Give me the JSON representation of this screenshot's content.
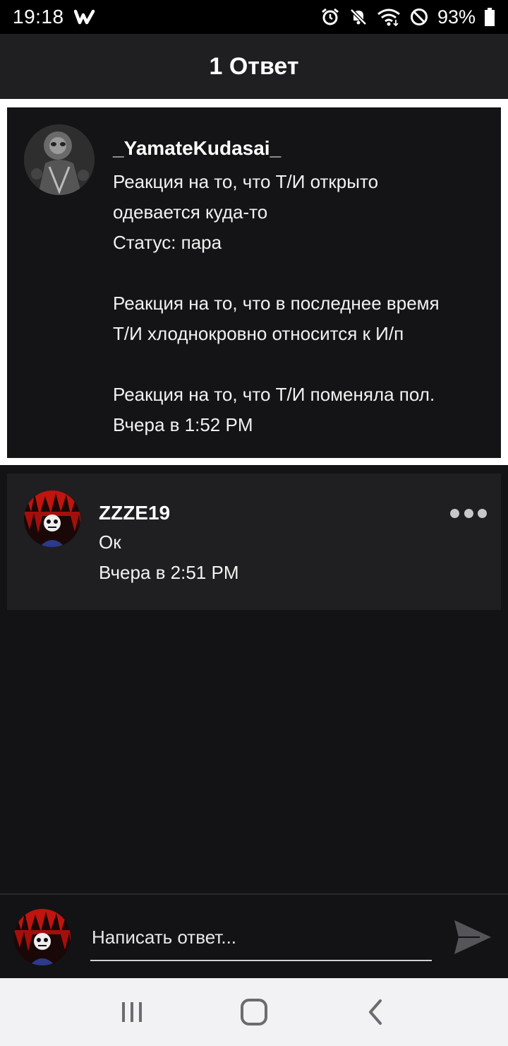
{
  "status_bar": {
    "time": "19:18",
    "battery_percent": "93%",
    "icons": [
      "wattpad-icon",
      "alarm-icon",
      "mute-icon",
      "wifi-icon",
      "do-not-disturb-icon",
      "battery-icon"
    ]
  },
  "header": {
    "title": "1 Ответ"
  },
  "parent_comment": {
    "username": "_YamateKudasai_",
    "text": "Реакция на то, что Т/И открыто\nодевается куда-то\nСтатус: пара\n\nРеакция на то, что в последнее время\nТ/И хлоднокровно относится к И/п\n\nРеакция на то, что Т/И поменяла пол.",
    "timestamp": "Вчера в 1:52 PM"
  },
  "replies": [
    {
      "username": "ZZZE19",
      "text": "Ок",
      "timestamp": "Вчера в 2:51 PM"
    }
  ],
  "reply_input": {
    "placeholder": "Написать ответ..."
  },
  "colors": {
    "background": "#131215",
    "card": "#1f1e21",
    "highlight": "#ffffff",
    "nav_bar": "#f2f1f3"
  }
}
